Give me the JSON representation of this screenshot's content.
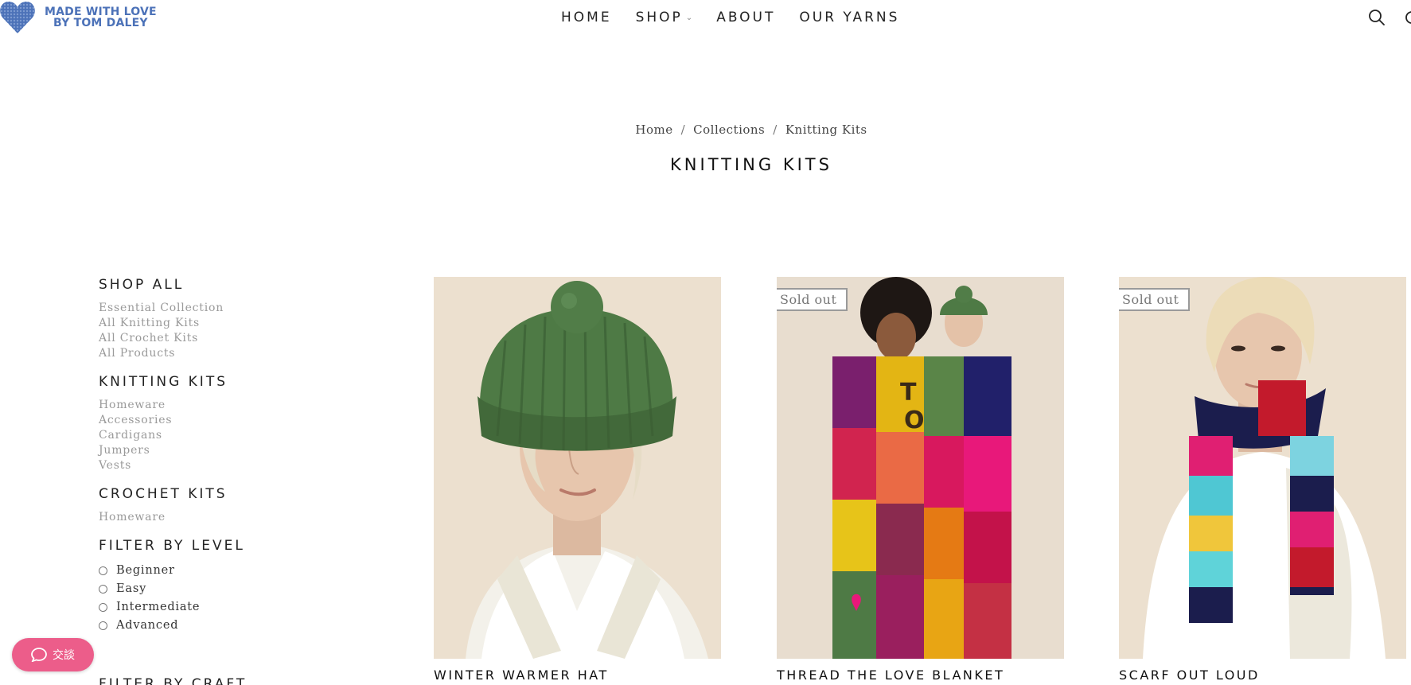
{
  "header": {
    "logo_line1": "MADE WITH LOVE",
    "logo_line2": "BY TOM DALEY",
    "nav": [
      {
        "label": "HOME"
      },
      {
        "label": "SHOP"
      },
      {
        "label": "ABOUT"
      },
      {
        "label": "OUR YARNS"
      }
    ],
    "brand_color": "#4c72b8"
  },
  "breadcrumb": [
    "Home",
    "Collections",
    "Knitting Kits"
  ],
  "breadcrumb_sep": "/",
  "page_title": "KNITTING KITS",
  "sidebar": {
    "sections": [
      {
        "heading": "SHOP ALL",
        "items": [
          "Essential Collection",
          "All Knitting Kits",
          "All Crochet Kits",
          "All Products"
        ]
      },
      {
        "heading": "KNITTING KITS",
        "items": [
          "Homeware",
          "Accessories",
          "Cardigans",
          "Jumpers",
          "Vests"
        ]
      },
      {
        "heading": "CROCHET KITS",
        "items": [
          "Homeware"
        ]
      }
    ],
    "filter_level": {
      "heading": "FILTER BY LEVEL",
      "options": [
        "Beginner",
        "Easy",
        "Intermediate",
        "Advanced"
      ]
    },
    "next_heading": "FILTER BY CRAFT"
  },
  "chat": {
    "label": "交談",
    "color": "#ec5d8a"
  },
  "products": [
    {
      "name": "WINTER WARMER HAT",
      "badge": ""
    },
    {
      "name": "THREAD THE LOVE BLANKET",
      "badge": "Sold out"
    },
    {
      "name": "SCARF OUT LOUD",
      "badge": "Sold out"
    }
  ]
}
